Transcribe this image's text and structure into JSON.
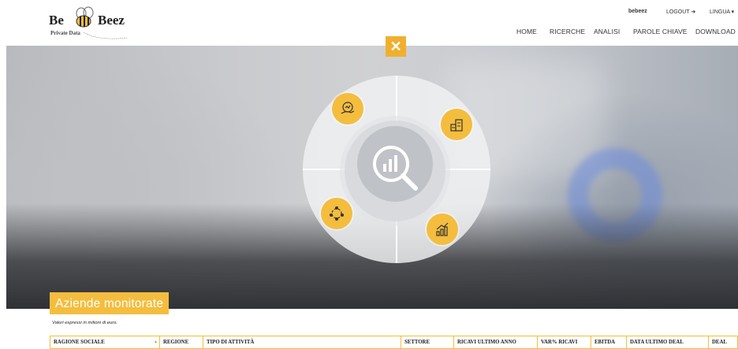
{
  "header": {
    "logo": {
      "part1": "Be",
      "part2": "Beez",
      "subtitle": "Private Data"
    },
    "user": "bebeez",
    "logout": "LOGOUT",
    "lingua": "LINGUA",
    "nav": [
      "HOME",
      "RICERCHE",
      "ANALISI",
      "PAROLE CHIAVE",
      "DOWNLOAD"
    ]
  },
  "hero": {
    "close_symbol": "✕",
    "wheel_buttons": [
      "analysis-hand-icon",
      "money-stack-icon",
      "network-cycle-icon",
      "growth-chart-icon"
    ],
    "center_icon": "search-chart-icon"
  },
  "section": {
    "title": "Aziende monitorate",
    "note": "Valori espressi in milioni di euro."
  },
  "table": {
    "columns": [
      "RAGIONE SOCIALE",
      "REGIONE",
      "TIPO DI ATTIVITÀ",
      "SETTORE",
      "RICAVI ULTIMO ANNO",
      "VAR% RICAVI",
      "EBITDA",
      "DATA ULTIMO DEAL",
      "DEAL"
    ]
  },
  "colors": {
    "accent": "#f4bd3e",
    "text": "#222222"
  }
}
